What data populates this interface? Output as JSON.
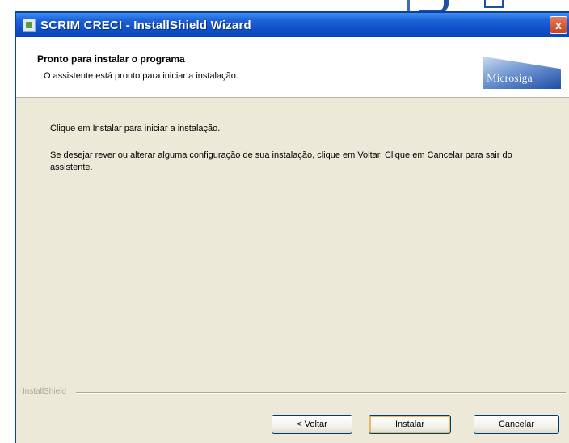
{
  "window": {
    "title": "SCRIM CRECI - InstallShield Wizard",
    "close_label": "x"
  },
  "header": {
    "title": "Pronto para instalar o programa",
    "subtitle": "O assistente está pronto para iniciar a instalação.",
    "logo_text": "Microsiga"
  },
  "content": {
    "line1": "Clique em Instalar para iniciar a instalação.",
    "line2": "Se desejar rever ou alterar alguma configuração de sua instalação, clique em Voltar. Clique em Cancelar para sair do assistente."
  },
  "footer": {
    "brand": "InstallShield"
  },
  "buttons": {
    "back": "< Voltar",
    "install": "Instalar",
    "cancel": "Cancelar"
  },
  "colors": {
    "titlebar": "#0e4fc9",
    "window_body": "#ece9d8",
    "header_bg": "#ffffff",
    "close_button": "#c5441f"
  }
}
